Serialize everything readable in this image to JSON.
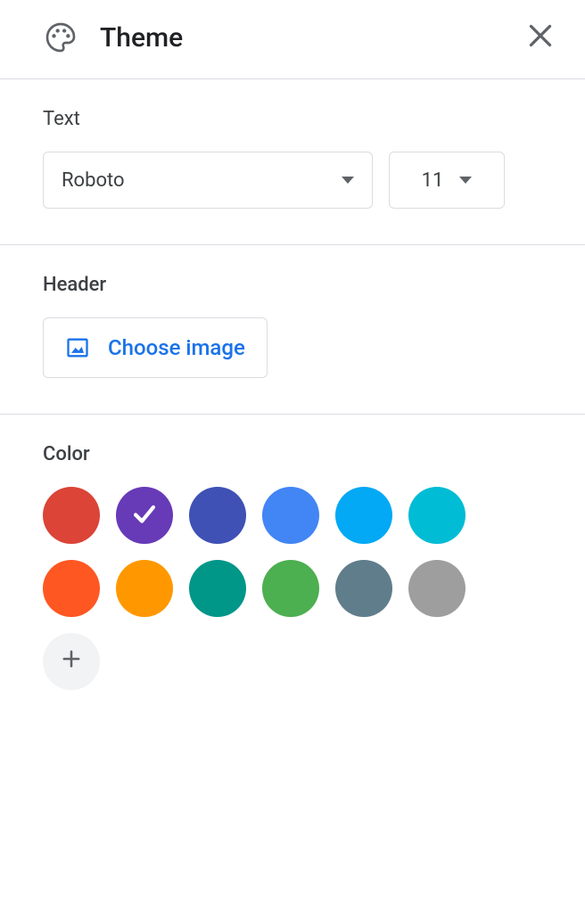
{
  "header": {
    "title": "Theme"
  },
  "text_section": {
    "label": "Text",
    "font": "Roboto",
    "size": "11"
  },
  "header_section": {
    "label": "Header",
    "choose_image_label": "Choose image"
  },
  "color_section": {
    "label": "Color",
    "selected_index": 1,
    "colors": [
      "#db4437",
      "#673ab7",
      "#3f51b5",
      "#4285f4",
      "#03a9f4",
      "#00bcd4",
      "#ff5722",
      "#ff9800",
      "#009688",
      "#4caf50",
      "#607d8b",
      "#9e9e9e"
    ]
  }
}
